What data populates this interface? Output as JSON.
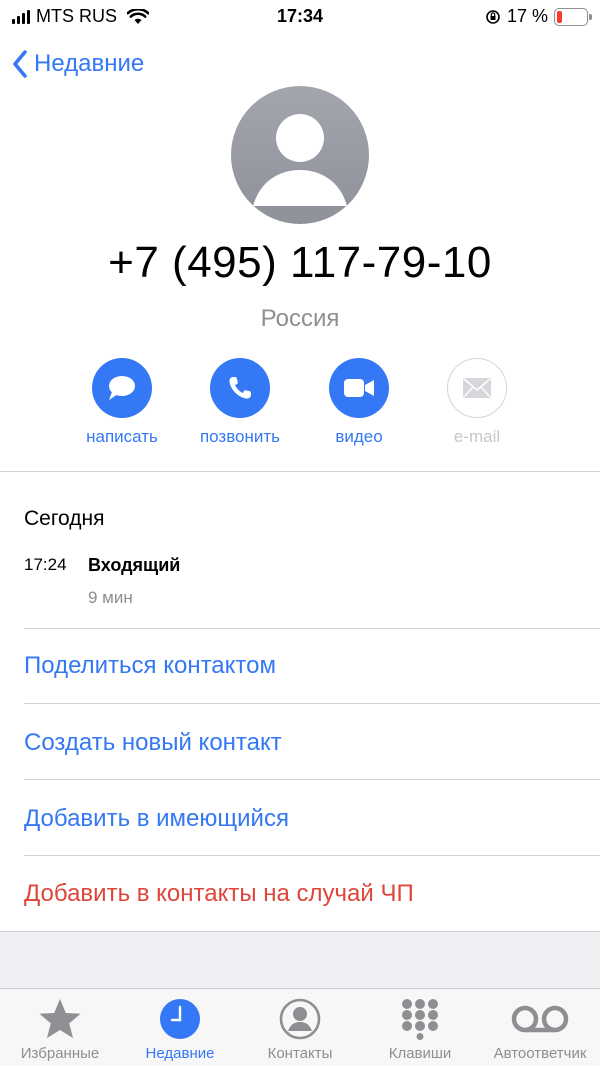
{
  "status_bar": {
    "carrier": "MTS RUS",
    "time": "17:34",
    "battery_percent": "17 %",
    "battery_level": 0.17,
    "battery_color": "#ff3b30"
  },
  "nav": {
    "back_label": "Недавние",
    "back_icon": "chevron-left-icon"
  },
  "contact": {
    "avatar_icon": "person-silhouette-icon",
    "phone": "+7 (495) 117-79-10",
    "country": "Россия"
  },
  "actions": [
    {
      "label": "написать",
      "icon": "message-icon",
      "enabled": true
    },
    {
      "label": "позвонить",
      "icon": "phone-icon",
      "enabled": true
    },
    {
      "label": "видео",
      "icon": "video-icon",
      "enabled": true
    },
    {
      "label": "e-mail",
      "icon": "mail-icon",
      "enabled": false
    }
  ],
  "calls": {
    "section_title": "Сегодня",
    "items": [
      {
        "time": "17:24",
        "type": "Входящий",
        "duration": "9 мин"
      }
    ]
  },
  "options": [
    {
      "label": "Поделиться контактом",
      "style": "default"
    },
    {
      "label": "Создать новый контакт",
      "style": "default"
    },
    {
      "label": "Добавить в имеющийся",
      "style": "default"
    },
    {
      "label": "Добавить в контакты на случай ЧП",
      "style": "danger"
    }
  ],
  "tabs": [
    {
      "label": "Избранные",
      "icon": "star-icon",
      "active": false
    },
    {
      "label": "Недавние",
      "icon": "clock-icon",
      "active": true
    },
    {
      "label": "Контакты",
      "icon": "contacts-icon",
      "active": false
    },
    {
      "label": "Клавиши",
      "icon": "keypad-icon",
      "active": false
    },
    {
      "label": "Автоответчик",
      "icon": "voicemail-icon",
      "active": false
    }
  ],
  "colors": {
    "accent": "#3478f6",
    "danger": "#e0453a",
    "secondary_text": "#8e8e93"
  }
}
